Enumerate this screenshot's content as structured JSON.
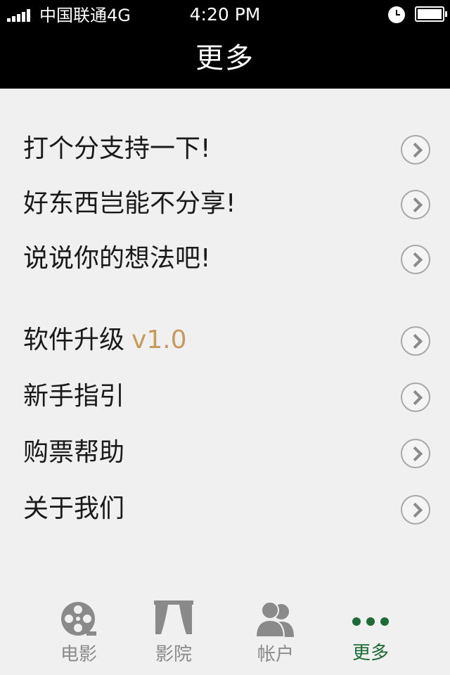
{
  "status_bar": {
    "carrier": "中国联通4G",
    "time": "4:20 PM"
  },
  "nav": {
    "title": "更多"
  },
  "menu": {
    "group1": [
      {
        "label": "打个分支持一下!"
      },
      {
        "label": "好东西岂能不分享!"
      },
      {
        "label": "说说你的想法吧!"
      }
    ],
    "group2": [
      {
        "label": "软件升级",
        "version": "v1.0"
      },
      {
        "label": "新手指引"
      },
      {
        "label": "购票帮助"
      },
      {
        "label": "关于我们"
      }
    ]
  },
  "tabbar": {
    "active": "更多",
    "active_color": "#1d6b35",
    "inactive_color": "#8a8a8a",
    "tabs": [
      {
        "label": "电影",
        "icon": "film-reel-icon"
      },
      {
        "label": "影院",
        "icon": "theater-curtain-icon"
      },
      {
        "label": "帐户",
        "icon": "users-icon"
      },
      {
        "label": "更多",
        "icon": "more-dots-icon"
      }
    ]
  },
  "colors": {
    "bar_background": "#000000",
    "page_background": "#f0f0f0",
    "version_accent": "#c59a5b"
  }
}
